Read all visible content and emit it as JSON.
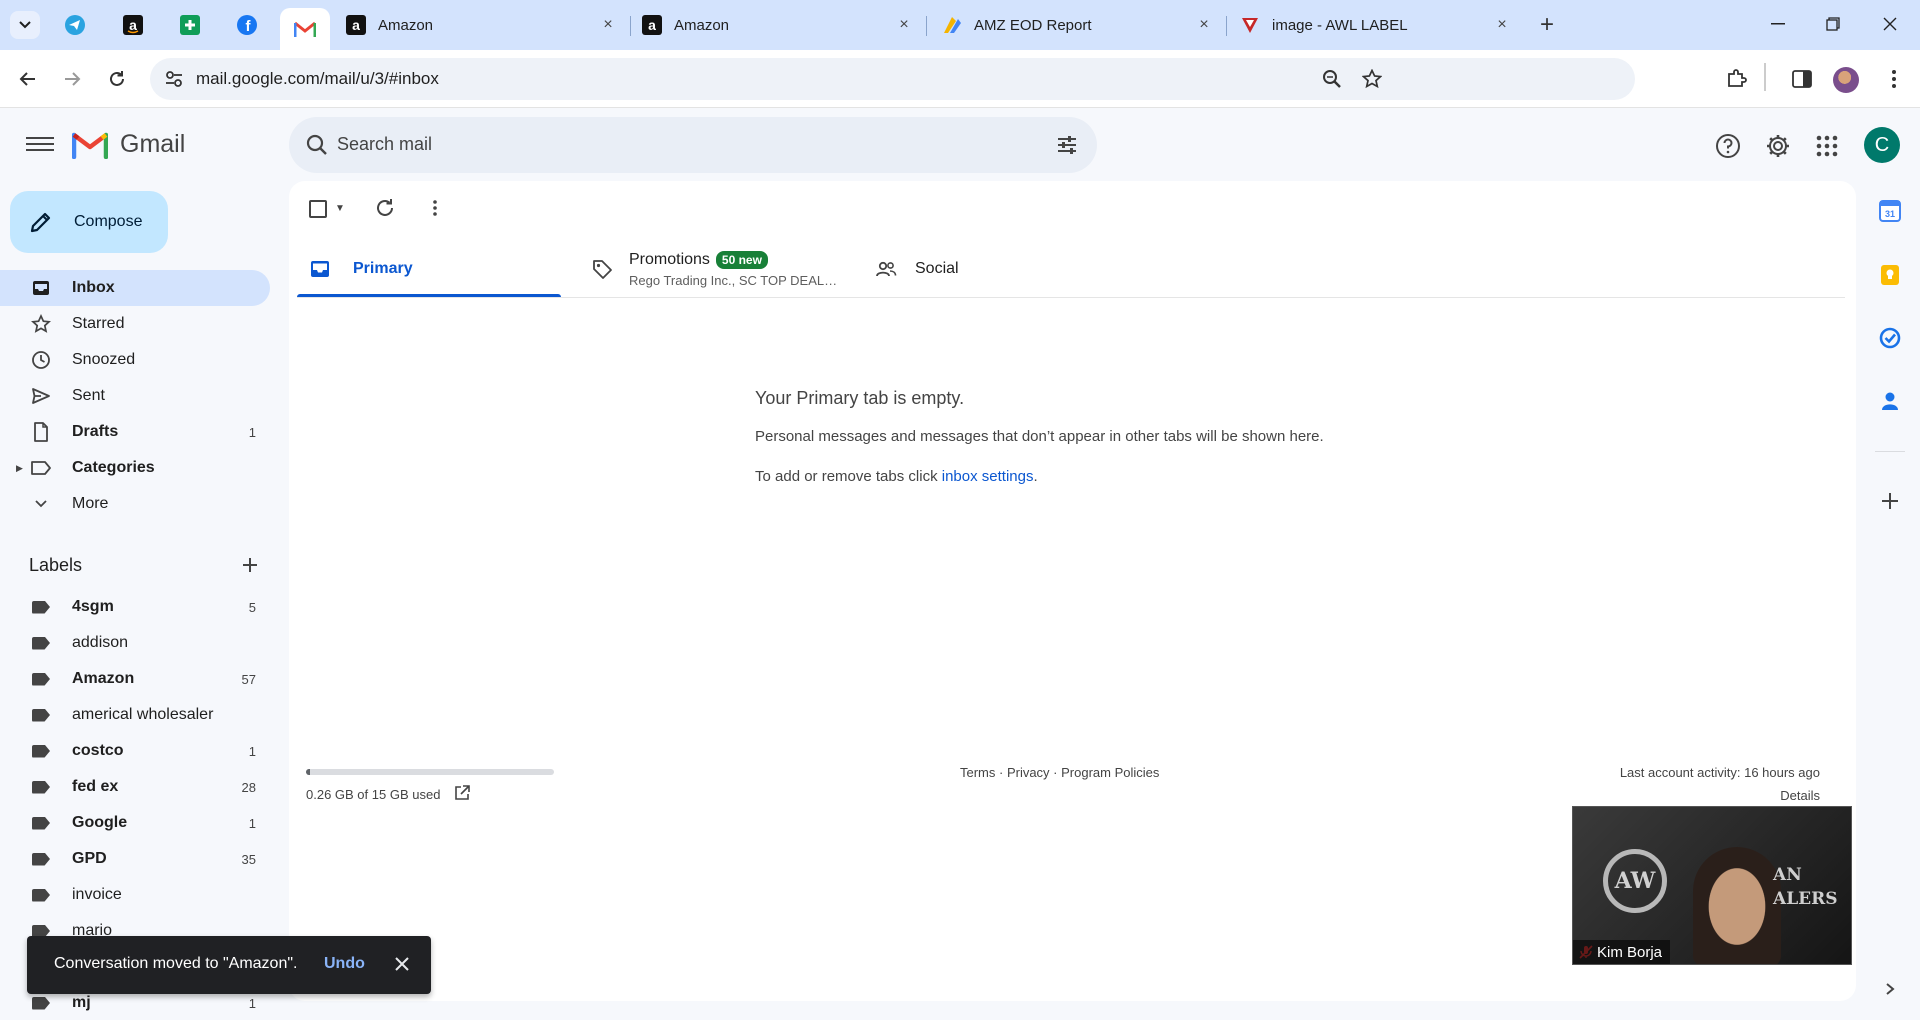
{
  "browser": {
    "tabs": [
      {
        "title": "Amazon",
        "close": "×"
      },
      {
        "title": "Amazon",
        "close": "×"
      },
      {
        "title": "AMZ EOD Report",
        "close": "×"
      },
      {
        "title": "image - AWL LABEL",
        "close": "×"
      }
    ],
    "new_tab": "+",
    "url": "mail.google.com/mail/u/3/#inbox"
  },
  "gmail": {
    "brand": "Gmail",
    "search_placeholder": "Search mail",
    "avatar_letter": "C",
    "compose": "Compose",
    "nav": [
      {
        "label": "Inbox",
        "count": ""
      },
      {
        "label": "Starred",
        "count": ""
      },
      {
        "label": "Snoozed",
        "count": ""
      },
      {
        "label": "Sent",
        "count": ""
      },
      {
        "label": "Drafts",
        "count": "1"
      },
      {
        "label": "Categories",
        "count": ""
      },
      {
        "label": "More",
        "count": ""
      }
    ],
    "labels_heading": "Labels",
    "labels": [
      {
        "name": "4sgm",
        "count": "5"
      },
      {
        "name": "addison",
        "count": ""
      },
      {
        "name": "Amazon",
        "count": "57"
      },
      {
        "name": "americal wholesaler",
        "count": ""
      },
      {
        "name": "costco",
        "count": "1"
      },
      {
        "name": "fed ex",
        "count": "28"
      },
      {
        "name": "Google",
        "count": "1"
      },
      {
        "name": "GPD",
        "count": "35"
      },
      {
        "name": "invoice",
        "count": ""
      },
      {
        "name": "mario",
        "count": ""
      },
      {
        "name": "mj",
        "count": "1"
      }
    ],
    "category_tabs": {
      "primary": "Primary",
      "promotions": "Promotions",
      "promotions_badge": "50 new",
      "promotions_senders": "Rego Trading Inc., SC TOP DEAL…",
      "social": "Social"
    },
    "empty": {
      "title": "Your Primary tab is empty.",
      "line1": "Personal messages and messages that don’t appear in other tabs will be shown here.",
      "line2_prefix": "To add or remove tabs click ",
      "line2_link": "inbox settings",
      "line2_suffix": "."
    },
    "footer": {
      "storage": "0.26 GB of 15 GB used",
      "storage_fraction": 0.017,
      "links": "Terms · Privacy · Program Policies",
      "activity": "Last account activity: 16 hours ago",
      "details": "Details"
    },
    "snackbar": {
      "message": "Conversation moved to \"Amazon\".",
      "undo": "Undo"
    }
  },
  "video": {
    "participant": "Kim Borja",
    "logo_text": "AW",
    "background_text_line1": "AN",
    "background_text_line2": "ALERS"
  },
  "colors": {
    "compose_bg": "#c2e7ff",
    "active_nav": "#d3e3fd",
    "primary_blue": "#0b57d0",
    "promo_badge": "#188038",
    "avatar": "#00796b"
  }
}
